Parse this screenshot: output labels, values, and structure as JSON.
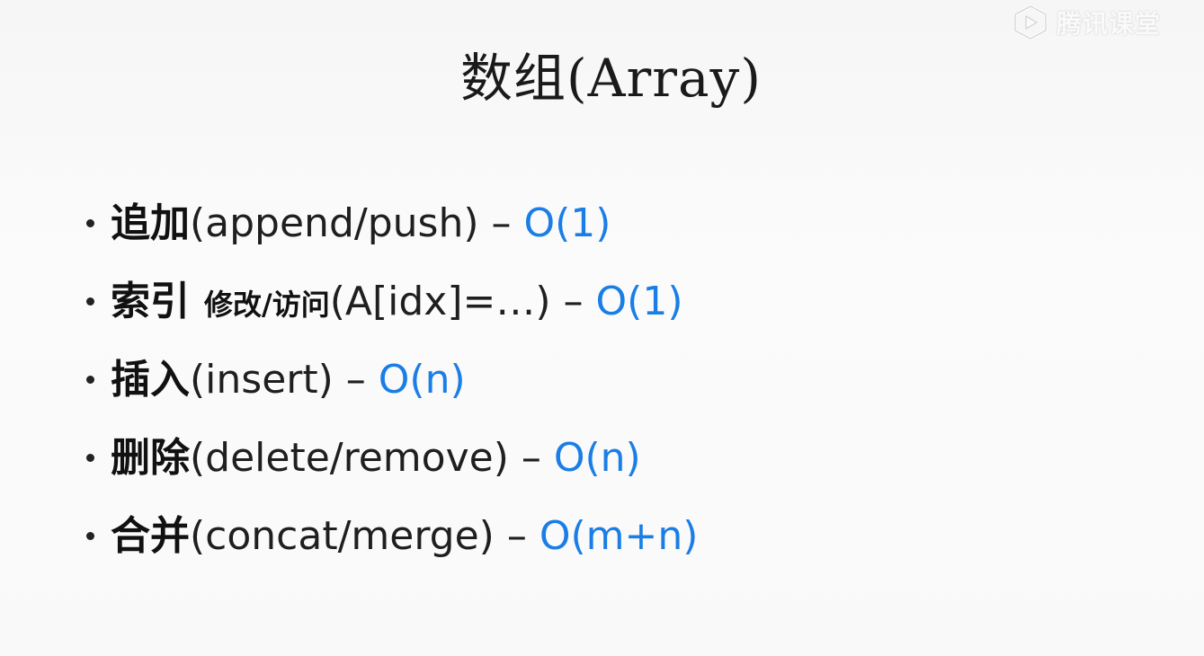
{
  "watermark": {
    "text": "腾讯课堂",
    "icon": "tencent-classroom-logo-icon"
  },
  "title": "数组(Array)",
  "items": [
    {
      "term": "追加",
      "sub": "",
      "detail": "(append/push)",
      "dash": "–",
      "complexity": "O(1)"
    },
    {
      "term": "索引",
      "sub": "修改/访问",
      "detail": "(A[idx]=…)",
      "dash": "–",
      "complexity": "O(1)"
    },
    {
      "term": "插入",
      "sub": "",
      "detail": "(insert)",
      "dash": "–",
      "complexity": "O(n)"
    },
    {
      "term": "删除",
      "sub": "",
      "detail": "(delete/remove)",
      "dash": "–",
      "complexity": "O(n)"
    },
    {
      "term": "合并",
      "sub": "",
      "detail": "(concat/merge)",
      "dash": "–",
      "complexity": "O(m+n)"
    }
  ],
  "colors": {
    "complexity": "#1a7ee6",
    "text": "#1f1f1f"
  }
}
